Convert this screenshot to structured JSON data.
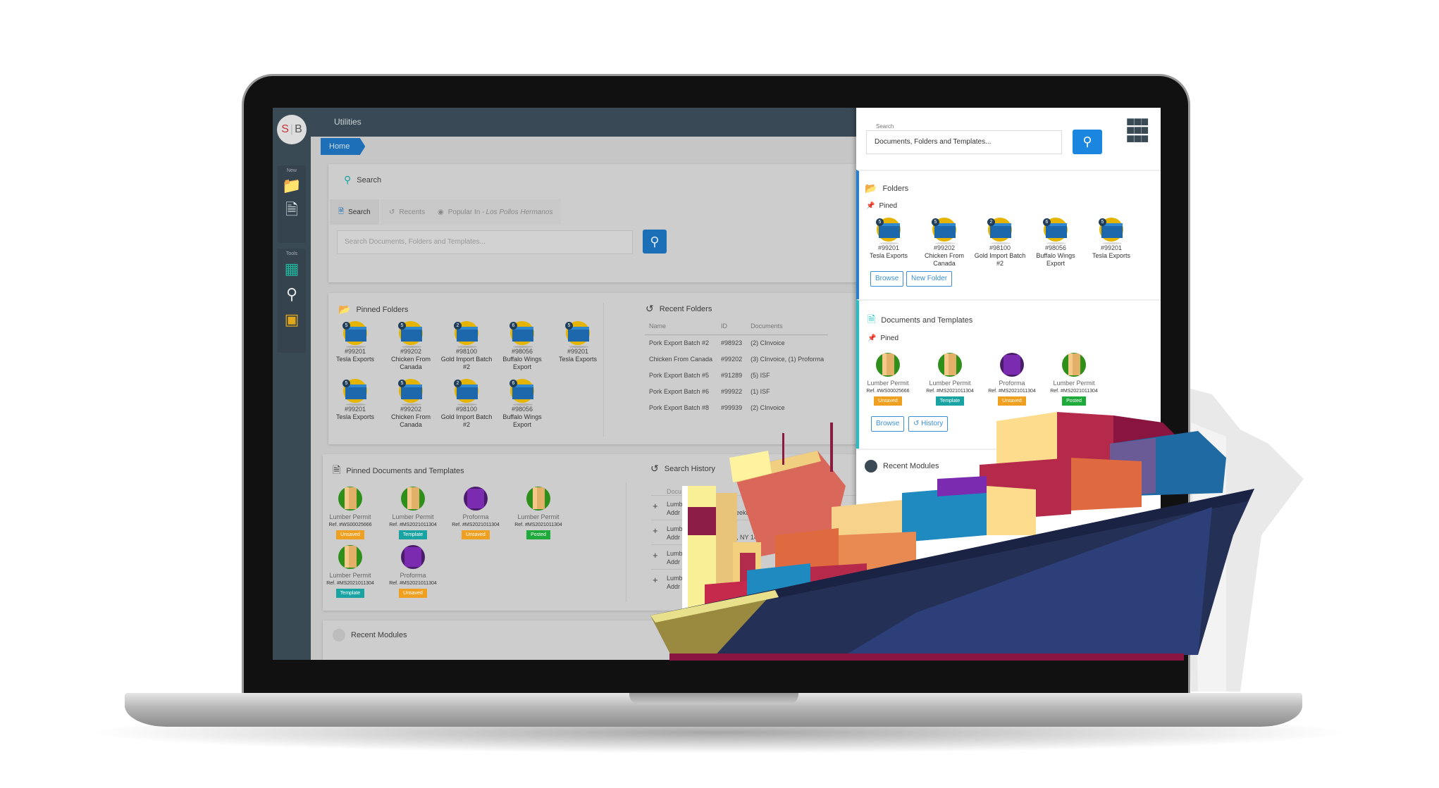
{
  "app": {
    "logo": {
      "left": "S",
      "right": "B"
    },
    "title": "Utilities",
    "breadcrumb": "Home"
  },
  "sidebar": {
    "new_label": "New",
    "tools_label": "Tools",
    "items": [
      {
        "icon": "new-folder-icon"
      },
      {
        "icon": "new-document-icon"
      },
      {
        "icon": "spreadsheet-icon"
      },
      {
        "icon": "search-icon"
      },
      {
        "icon": "toolbox-icon"
      }
    ]
  },
  "search_card": {
    "title": "Search",
    "tabs": [
      {
        "label": "Search",
        "active": true
      },
      {
        "label": "Recents"
      },
      {
        "label": "Popular In - ",
        "label_italic": "Los Pollos Hermanos"
      }
    ],
    "placeholder": "Search Documents, Folders and Templates..."
  },
  "pinned_folders": {
    "title": "Pinned Folders",
    "items": [
      {
        "badge": "5",
        "id": "#99201",
        "name": "Tesla Exports"
      },
      {
        "badge": "5",
        "id": "#99202",
        "name": "Chicken From Canada"
      },
      {
        "badge": "2",
        "id": "#98100",
        "name": "Gold Import Batch #2"
      },
      {
        "badge": "6",
        "id": "#98056",
        "name": "Buffalo Wings Export"
      },
      {
        "badge": "5",
        "id": "#99201",
        "name": "Tesla Exports"
      },
      {
        "badge": "5",
        "id": "#99201",
        "name": "Tesla Exports"
      },
      {
        "badge": "5",
        "id": "#99202",
        "name": "Chicken From Canada"
      },
      {
        "badge": "2",
        "id": "#98100",
        "name": "Gold Import Batch #2"
      },
      {
        "badge": "6",
        "id": "#98056",
        "name": "Buffalo Wings Export"
      }
    ]
  },
  "recent_folders": {
    "title": "Recent Folders",
    "columns": [
      "Name",
      "ID",
      "Documents"
    ],
    "rows": [
      [
        "Pork Export Batch #2",
        "#98923",
        "(2)  CInvoice"
      ],
      [
        "Chicken From Canada",
        "#99202",
        "(3)  CInvoice, (1) Proforma"
      ],
      [
        "Pork Export Batch #5",
        "#91289",
        "(5) ISF"
      ],
      [
        "Pork Export Batch #6",
        "#99922",
        "(1) ISF"
      ],
      [
        "Pork Export Batch #8",
        "#99939",
        "(2)  CInvoice"
      ]
    ]
  },
  "pinned_docs": {
    "title": "Pinned Documents and Templates",
    "items": [
      {
        "type": "lumber",
        "name": "Lumber Permit",
        "ref": "Ref. #WS00025666",
        "status": "Unsaved"
      },
      {
        "type": "lumber",
        "name": "Lumber Permit",
        "ref": "Ref. #MS2021011304",
        "status": "Template"
      },
      {
        "type": "proforma",
        "name": "Proforma",
        "ref": "Ref. #MS2021011304",
        "status": "Unsaved"
      },
      {
        "type": "lumber",
        "name": "Lumber Permit",
        "ref": "Ref. #MS2021011304",
        "status": "Posted"
      },
      {
        "type": "lumber",
        "name": "Lumber Permit",
        "ref": "Ref. #MS2021011304",
        "status": "Template"
      },
      {
        "type": "proforma",
        "name": "Proforma",
        "ref": "Ref. #MS2021011304",
        "status": "Unsaved"
      }
    ]
  },
  "search_history": {
    "title": "Search History",
    "column": "Docu",
    "rows": [
      {
        "line1": "Lumb          Consignee",
        "line2": "Addr          Union Rd, Cheektowaga, NY 14"
      },
      {
        "line1": "Lumb",
        "line2": "Addr          Cheektowaga, NY 14"
      },
      {
        "line1": "Lumb",
        "line2": "Addr"
      },
      {
        "line1": "Lumb",
        "line2": "Addr"
      }
    ]
  },
  "recent_modules": {
    "title": "Recent Modules"
  },
  "right_panel": {
    "search_label": "Search",
    "search_value": "Documents, Folders and Templates...",
    "folders_title": "Folders",
    "pinned_label": "Pined",
    "folders": [
      {
        "badge": "5",
        "id": "#99201",
        "name": "Tesla Exports"
      },
      {
        "badge": "5",
        "id": "#99202",
        "name": "Chicken From Canada"
      },
      {
        "badge": "2",
        "id": "#98100",
        "name": "Gold Import Batch #2"
      },
      {
        "badge": "6",
        "id": "#98056",
        "name": "Buffalo Wings Export"
      },
      {
        "badge": "5",
        "id": "#99201",
        "name": "Tesla Exports"
      }
    ],
    "folder_buttons": {
      "browse": "Browse",
      "new_folder": "New Folder"
    },
    "docs_title": "Documents and Templates",
    "docs": [
      {
        "type": "lumber",
        "name": "Lumber Permit",
        "ref": "Ref. #WS00025666",
        "status": "Unsaved"
      },
      {
        "type": "lumber",
        "name": "Lumber Permit",
        "ref": "Ref. #MS2021011304",
        "status": "Template"
      },
      {
        "type": "proforma",
        "name": "Proforma",
        "ref": "Ref. #MS2021011304",
        "status": "Unsaved"
      },
      {
        "type": "lumber",
        "name": "Lumber Permit",
        "ref": "Ref. #MS2021011304",
        "status": "Posted"
      }
    ],
    "doc_buttons": {
      "browse": "Browse",
      "history": "History"
    },
    "recent_modules": "Recent Modules"
  },
  "colors": {
    "accent": "#1a6fb6",
    "sidebar": "#3a4a55",
    "unsaved": "#f0a020",
    "template": "#1aa3a3",
    "posted": "#1faa3c"
  }
}
